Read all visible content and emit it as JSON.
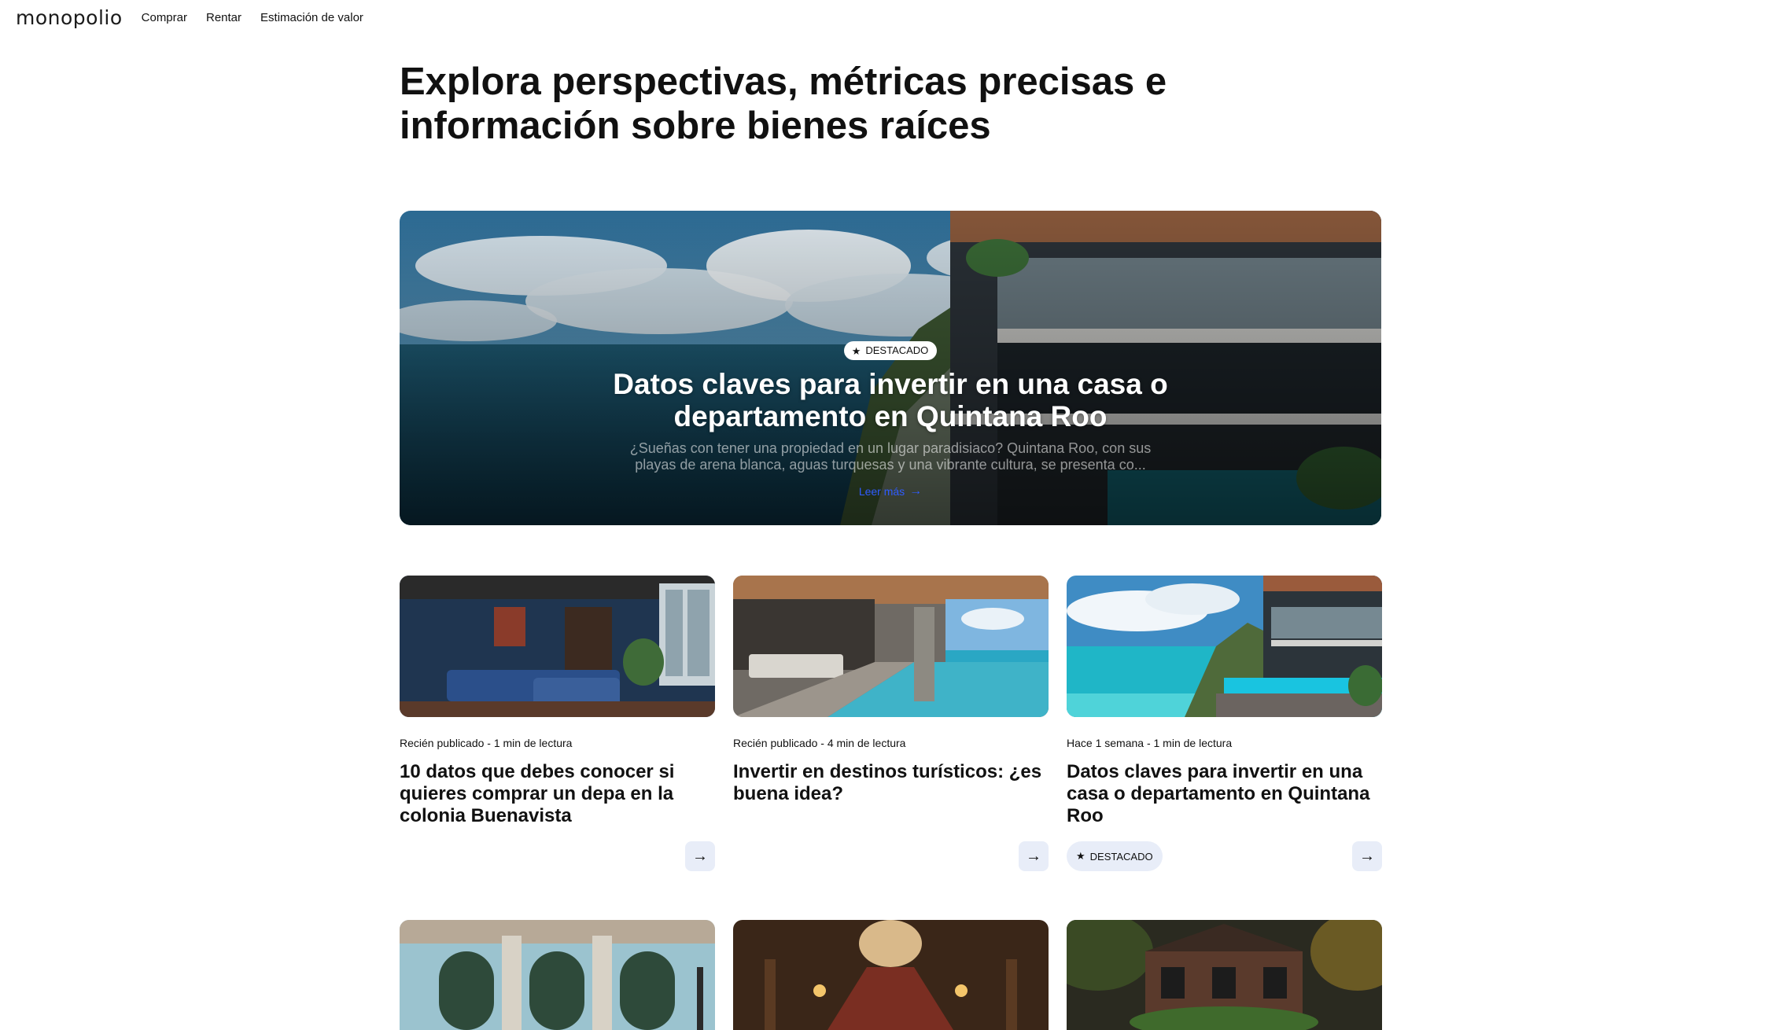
{
  "nav": {
    "logo": "monopolio",
    "links": [
      "Comprar",
      "Rentar",
      "Estimación de valor"
    ]
  },
  "page": {
    "title": "Explora perspectivas, métricas precisas e información sobre bienes raíces"
  },
  "hero": {
    "badge": "DESTACADO",
    "title": "Datos claves para invertir en una casa o departamento en Quintana Roo",
    "excerpt": "¿Sueñas con tener una propiedad en un lugar paradisiaco? Quintana Roo, con sus playas de arena blanca, aguas turquesas y una vibrante cultura, se presenta co...",
    "read_more": "Leer más",
    "link_color": "#2f5cff"
  },
  "cards": [
    {
      "meta": "Recién publicado - 1 min de lectura",
      "title": "10 datos que debes conocer si quieres comprar un depa en la colonia Buenavista",
      "image": "blue-living-room"
    },
    {
      "meta": "Recién publicado - 4 min de lectura",
      "title": "Invertir en destinos turísticos: ¿es buena idea?",
      "image": "infinity-pool-interior"
    },
    {
      "meta": "Hace 1 semana - 1 min de lectura",
      "title": "Datos claves para invertir en una casa o departamento en Quintana Roo",
      "image": "cliff-villa-pool",
      "badge": "DESTACADO"
    }
  ],
  "more_cards": [
    {
      "image": "ornate-facade"
    },
    {
      "image": "grand-staircase"
    },
    {
      "image": "victorian-mansion"
    }
  ],
  "colors": {
    "accent": "#2f5cff",
    "chip_bg": "#e8edf8"
  }
}
